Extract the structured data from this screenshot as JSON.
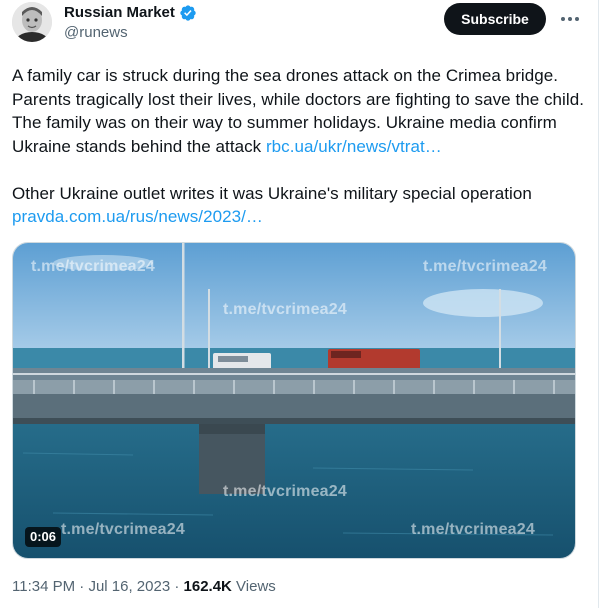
{
  "author": {
    "display_name": "Russian Market",
    "handle": "@runews",
    "verified": true,
    "verified_color": "#1d9bf0"
  },
  "actions": {
    "subscribe_label": "Subscribe",
    "more_icon": "more-horizontal-icon"
  },
  "tweet": {
    "paragraph1_text": "A family car is struck during the sea drones attack on the Crimea bridge. Parents tragically lost their lives, while doctors are fighting to save the child. The family was on their way to summer holidays. Ukraine media confirm Ukraine stands behind the attack ",
    "paragraph1_link": "rbc.ua/ukr/news/vtrat…",
    "paragraph2_text": "Other Ukraine outlet writes it was Ukraine's military special operation",
    "paragraph2_link": "pravda.com.ua/rus/news/2023/…",
    "link_color": "#1d9bf0"
  },
  "media": {
    "watermarks": [
      "t.me/tvcrimea24",
      "t.me/tvcrimea24",
      "t.me/tvcrimea24",
      "t.me/tvcrimea24",
      "t.me/tvcrimea24",
      "t.me/tvcrimea24"
    ],
    "duration": "0:06"
  },
  "meta": {
    "time": "11:34 PM",
    "separator": " · ",
    "date": "Jul 16, 2023",
    "views_count": "162.4K",
    "views_label": " Views"
  }
}
